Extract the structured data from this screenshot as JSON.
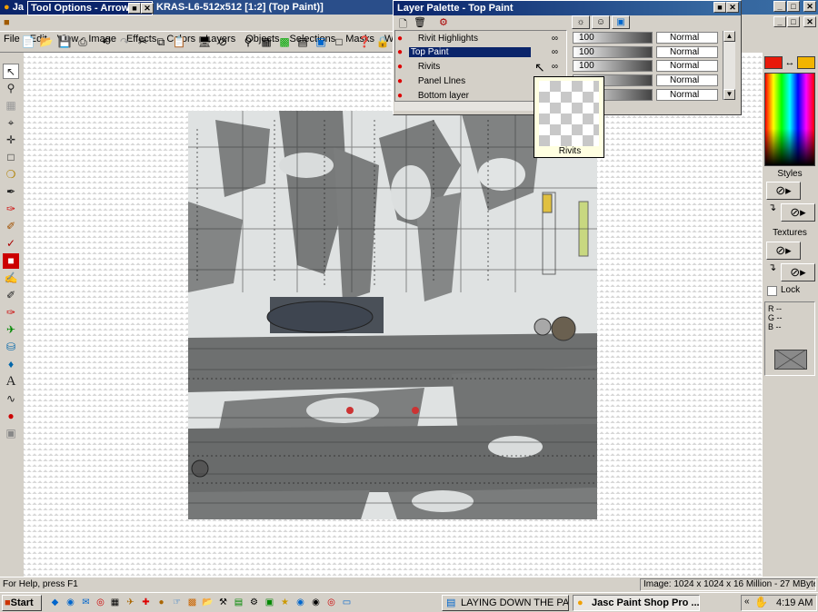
{
  "window": {
    "title_fragment": "Ja",
    "doc_title": "KRAS-L6-512x512 [1:2] (Top Paint)]"
  },
  "menu": [
    "File",
    "Edit",
    "View",
    "Image",
    "Effects",
    "Colors",
    "Layers",
    "Objects",
    "Selections",
    "Masks",
    "Window"
  ],
  "tool_options": {
    "title": "Tool Options - Arrow"
  },
  "layer_palette": {
    "title": "Layer Palette - Top Paint",
    "layers": [
      {
        "name": "Rivit Highlights",
        "opacity": "100",
        "blend": "Normal",
        "selected": false
      },
      {
        "name": "Top Paint",
        "opacity": "100",
        "blend": "Normal",
        "selected": true
      },
      {
        "name": "Rivits",
        "opacity": "100",
        "blend": "Normal",
        "selected": false
      },
      {
        "name": "Panel Llnes",
        "opacity": "",
        "blend": "Normal",
        "selected": false
      },
      {
        "name": "Bottom layer",
        "opacity": "",
        "blend": "Normal",
        "selected": false
      }
    ],
    "tooltip_label": "Rivits"
  },
  "right_panel": {
    "styles_label": "Styles",
    "textures_label": "Textures",
    "lock_label": "Lock",
    "rgb": [
      "R --",
      "G --",
      "B --"
    ],
    "fg_color": "#e8190a",
    "bg_color": "#f2b400"
  },
  "status": {
    "help": "For Help, press F1",
    "image_info": "Image:  1024 x 1024 x 16 Million - 27 MBytes"
  },
  "taskbar": {
    "start": "Start",
    "tasks": [
      "LAYING DOWN THE PAI...",
      "Jasc Paint Shop Pro ..."
    ],
    "clock": "4:19 AM"
  }
}
